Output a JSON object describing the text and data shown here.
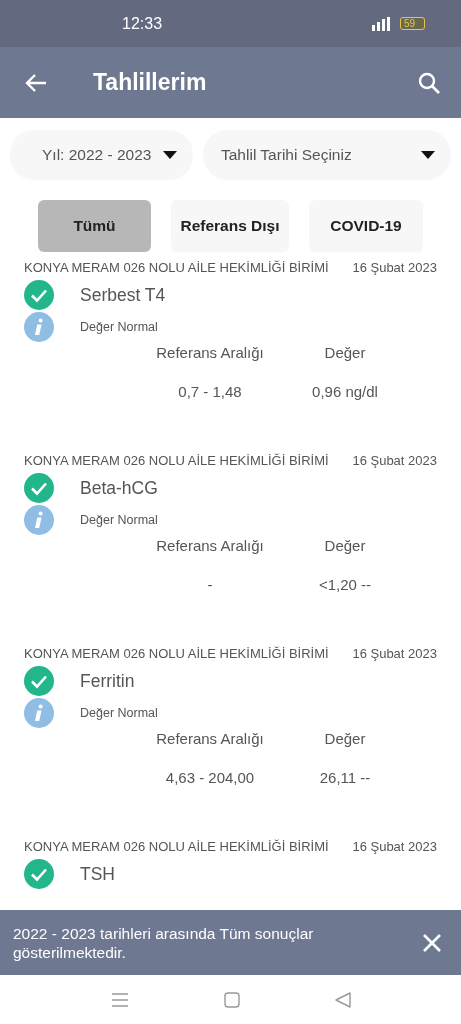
{
  "status_bar": {
    "time": "12:33",
    "battery": "59"
  },
  "app_bar": {
    "title": "Tahlillerim"
  },
  "dropdowns": [
    {
      "value": "Yıl: 2022 - 2023"
    },
    {
      "value": "Tahlil Tarihi Seçiniz"
    }
  ],
  "filters": [
    {
      "label": "Tümü",
      "selected": true
    },
    {
      "label": "Referans Dışı",
      "selected": false
    },
    {
      "label": "COVID-19",
      "selected": false
    }
  ],
  "results": [
    {
      "institution": "KONYA MERAM 026 NOLU AİLE HEKİMLİĞİ BİRİMİ",
      "date": "16 Şubat 2023",
      "test": "Serbest T4",
      "normal": true,
      "status": "Değer Normal",
      "range_label": "Referans Aralığı",
      "value_label": "Değer",
      "range": "0,7 - 1,48",
      "value": "0,96 ng/dl"
    },
    {
      "institution": "KONYA MERAM 026 NOLU AİLE HEKİMLİĞİ BİRİMİ",
      "date": "16 Şubat 2023",
      "test": "Beta-hCG",
      "normal": true,
      "status": "Değer Normal",
      "range_label": "Referans Aralığı",
      "value_label": "Değer",
      "range": "-",
      "value": "<1,20 --"
    },
    {
      "institution": "KONYA MERAM 026 NOLU AİLE HEKİMLİĞİ BİRİMİ",
      "date": "16 Şubat 2023",
      "test": "Ferritin",
      "normal": true,
      "status": "Değer Normal",
      "range_label": "Referans Aralığı",
      "value_label": "Değer",
      "range": "4,63 - 204,00",
      "value": "26,11 --"
    },
    {
      "institution": "KONYA MERAM 026 NOLU AİLE HEKİMLİĞİ BİRİMİ",
      "date": "16 Şubat 2023",
      "test": "TSH",
      "normal": true
    }
  ],
  "snackbar": {
    "message": "2022 - 2023 tarihleri arasında Tüm sonuçlar gösterilmektedir."
  }
}
